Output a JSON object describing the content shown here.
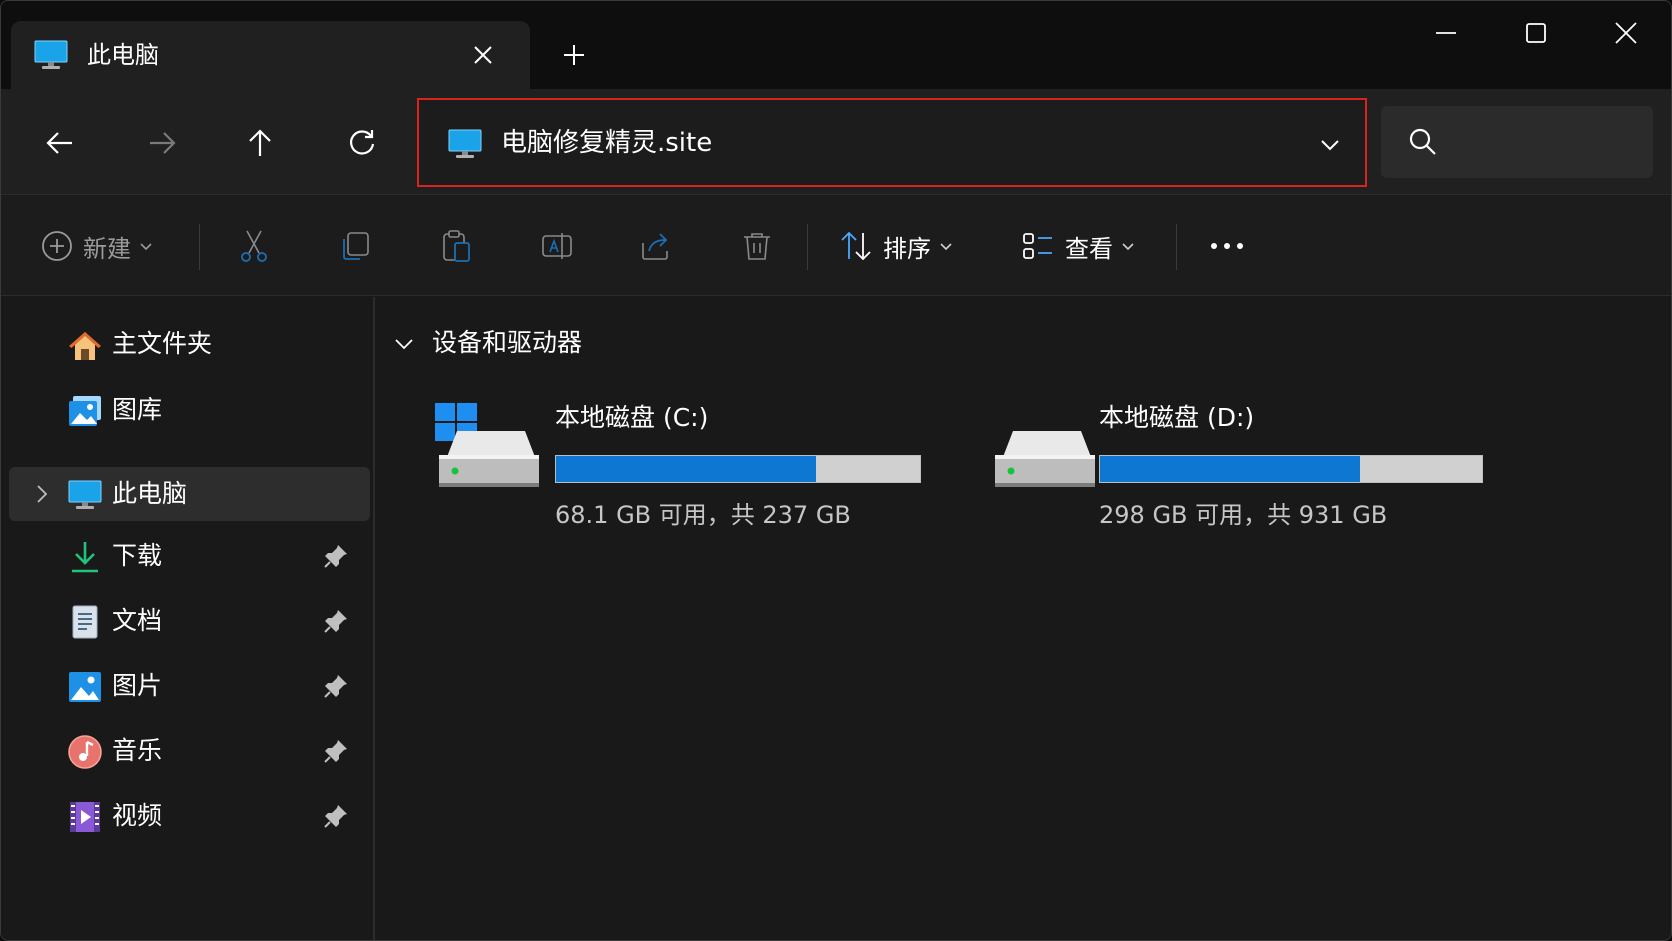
{
  "tab": {
    "title": "此电脑"
  },
  "address": {
    "path": "电脑修复精灵.site"
  },
  "commands": {
    "new_label": "新建",
    "sort_label": "排序",
    "view_label": "查看"
  },
  "sidebar": {
    "items": [
      {
        "label": "主文件夹",
        "icon": "home-icon"
      },
      {
        "label": "图库",
        "icon": "gallery-icon"
      },
      {
        "label": "此电脑",
        "icon": "computer-icon",
        "selected": true
      },
      {
        "label": "下载",
        "icon": "download-icon",
        "pinned": true
      },
      {
        "label": "文档",
        "icon": "document-icon",
        "pinned": true
      },
      {
        "label": "图片",
        "icon": "pictures-icon",
        "pinned": true
      },
      {
        "label": "音乐",
        "icon": "music-icon",
        "pinned": true
      },
      {
        "label": "视频",
        "icon": "video-icon",
        "pinned": true
      }
    ]
  },
  "content": {
    "group_title": "设备和驱动器",
    "drives": [
      {
        "name": "本地磁盘 (C:)",
        "space": "68.1 GB 可用，共 237 GB",
        "used_fraction": 0.713
      },
      {
        "name": "本地磁盘 (D:)",
        "space": "298 GB 可用，共 931 GB",
        "used_fraction": 0.68
      }
    ]
  },
  "colors": {
    "accent": "#0e77d2",
    "address_border": "#d8241c",
    "background": "#191919"
  }
}
